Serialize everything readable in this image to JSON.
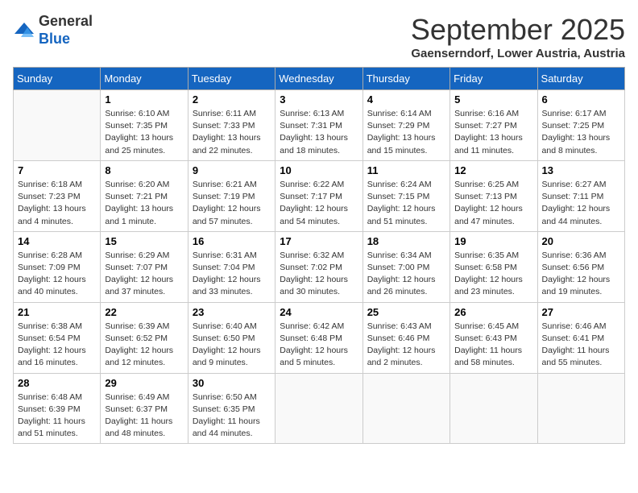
{
  "logo": {
    "general": "General",
    "blue": "Blue"
  },
  "title": "September 2025",
  "subtitle": "Gaenserndorf, Lower Austria, Austria",
  "weekdays": [
    "Sunday",
    "Monday",
    "Tuesday",
    "Wednesday",
    "Thursday",
    "Friday",
    "Saturday"
  ],
  "weeks": [
    [
      {
        "day": "",
        "info": ""
      },
      {
        "day": "1",
        "info": "Sunrise: 6:10 AM\nSunset: 7:35 PM\nDaylight: 13 hours\nand 25 minutes."
      },
      {
        "day": "2",
        "info": "Sunrise: 6:11 AM\nSunset: 7:33 PM\nDaylight: 13 hours\nand 22 minutes."
      },
      {
        "day": "3",
        "info": "Sunrise: 6:13 AM\nSunset: 7:31 PM\nDaylight: 13 hours\nand 18 minutes."
      },
      {
        "day": "4",
        "info": "Sunrise: 6:14 AM\nSunset: 7:29 PM\nDaylight: 13 hours\nand 15 minutes."
      },
      {
        "day": "5",
        "info": "Sunrise: 6:16 AM\nSunset: 7:27 PM\nDaylight: 13 hours\nand 11 minutes."
      },
      {
        "day": "6",
        "info": "Sunrise: 6:17 AM\nSunset: 7:25 PM\nDaylight: 13 hours\nand 8 minutes."
      }
    ],
    [
      {
        "day": "7",
        "info": "Sunrise: 6:18 AM\nSunset: 7:23 PM\nDaylight: 13 hours\nand 4 minutes."
      },
      {
        "day": "8",
        "info": "Sunrise: 6:20 AM\nSunset: 7:21 PM\nDaylight: 13 hours\nand 1 minute."
      },
      {
        "day": "9",
        "info": "Sunrise: 6:21 AM\nSunset: 7:19 PM\nDaylight: 12 hours\nand 57 minutes."
      },
      {
        "day": "10",
        "info": "Sunrise: 6:22 AM\nSunset: 7:17 PM\nDaylight: 12 hours\nand 54 minutes."
      },
      {
        "day": "11",
        "info": "Sunrise: 6:24 AM\nSunset: 7:15 PM\nDaylight: 12 hours\nand 51 minutes."
      },
      {
        "day": "12",
        "info": "Sunrise: 6:25 AM\nSunset: 7:13 PM\nDaylight: 12 hours\nand 47 minutes."
      },
      {
        "day": "13",
        "info": "Sunrise: 6:27 AM\nSunset: 7:11 PM\nDaylight: 12 hours\nand 44 minutes."
      }
    ],
    [
      {
        "day": "14",
        "info": "Sunrise: 6:28 AM\nSunset: 7:09 PM\nDaylight: 12 hours\nand 40 minutes."
      },
      {
        "day": "15",
        "info": "Sunrise: 6:29 AM\nSunset: 7:07 PM\nDaylight: 12 hours\nand 37 minutes."
      },
      {
        "day": "16",
        "info": "Sunrise: 6:31 AM\nSunset: 7:04 PM\nDaylight: 12 hours\nand 33 minutes."
      },
      {
        "day": "17",
        "info": "Sunrise: 6:32 AM\nSunset: 7:02 PM\nDaylight: 12 hours\nand 30 minutes."
      },
      {
        "day": "18",
        "info": "Sunrise: 6:34 AM\nSunset: 7:00 PM\nDaylight: 12 hours\nand 26 minutes."
      },
      {
        "day": "19",
        "info": "Sunrise: 6:35 AM\nSunset: 6:58 PM\nDaylight: 12 hours\nand 23 minutes."
      },
      {
        "day": "20",
        "info": "Sunrise: 6:36 AM\nSunset: 6:56 PM\nDaylight: 12 hours\nand 19 minutes."
      }
    ],
    [
      {
        "day": "21",
        "info": "Sunrise: 6:38 AM\nSunset: 6:54 PM\nDaylight: 12 hours\nand 16 minutes."
      },
      {
        "day": "22",
        "info": "Sunrise: 6:39 AM\nSunset: 6:52 PM\nDaylight: 12 hours\nand 12 minutes."
      },
      {
        "day": "23",
        "info": "Sunrise: 6:40 AM\nSunset: 6:50 PM\nDaylight: 12 hours\nand 9 minutes."
      },
      {
        "day": "24",
        "info": "Sunrise: 6:42 AM\nSunset: 6:48 PM\nDaylight: 12 hours\nand 5 minutes."
      },
      {
        "day": "25",
        "info": "Sunrise: 6:43 AM\nSunset: 6:46 PM\nDaylight: 12 hours\nand 2 minutes."
      },
      {
        "day": "26",
        "info": "Sunrise: 6:45 AM\nSunset: 6:43 PM\nDaylight: 11 hours\nand 58 minutes."
      },
      {
        "day": "27",
        "info": "Sunrise: 6:46 AM\nSunset: 6:41 PM\nDaylight: 11 hours\nand 55 minutes."
      }
    ],
    [
      {
        "day": "28",
        "info": "Sunrise: 6:48 AM\nSunset: 6:39 PM\nDaylight: 11 hours\nand 51 minutes."
      },
      {
        "day": "29",
        "info": "Sunrise: 6:49 AM\nSunset: 6:37 PM\nDaylight: 11 hours\nand 48 minutes."
      },
      {
        "day": "30",
        "info": "Sunrise: 6:50 AM\nSunset: 6:35 PM\nDaylight: 11 hours\nand 44 minutes."
      },
      {
        "day": "",
        "info": ""
      },
      {
        "day": "",
        "info": ""
      },
      {
        "day": "",
        "info": ""
      },
      {
        "day": "",
        "info": ""
      }
    ]
  ]
}
